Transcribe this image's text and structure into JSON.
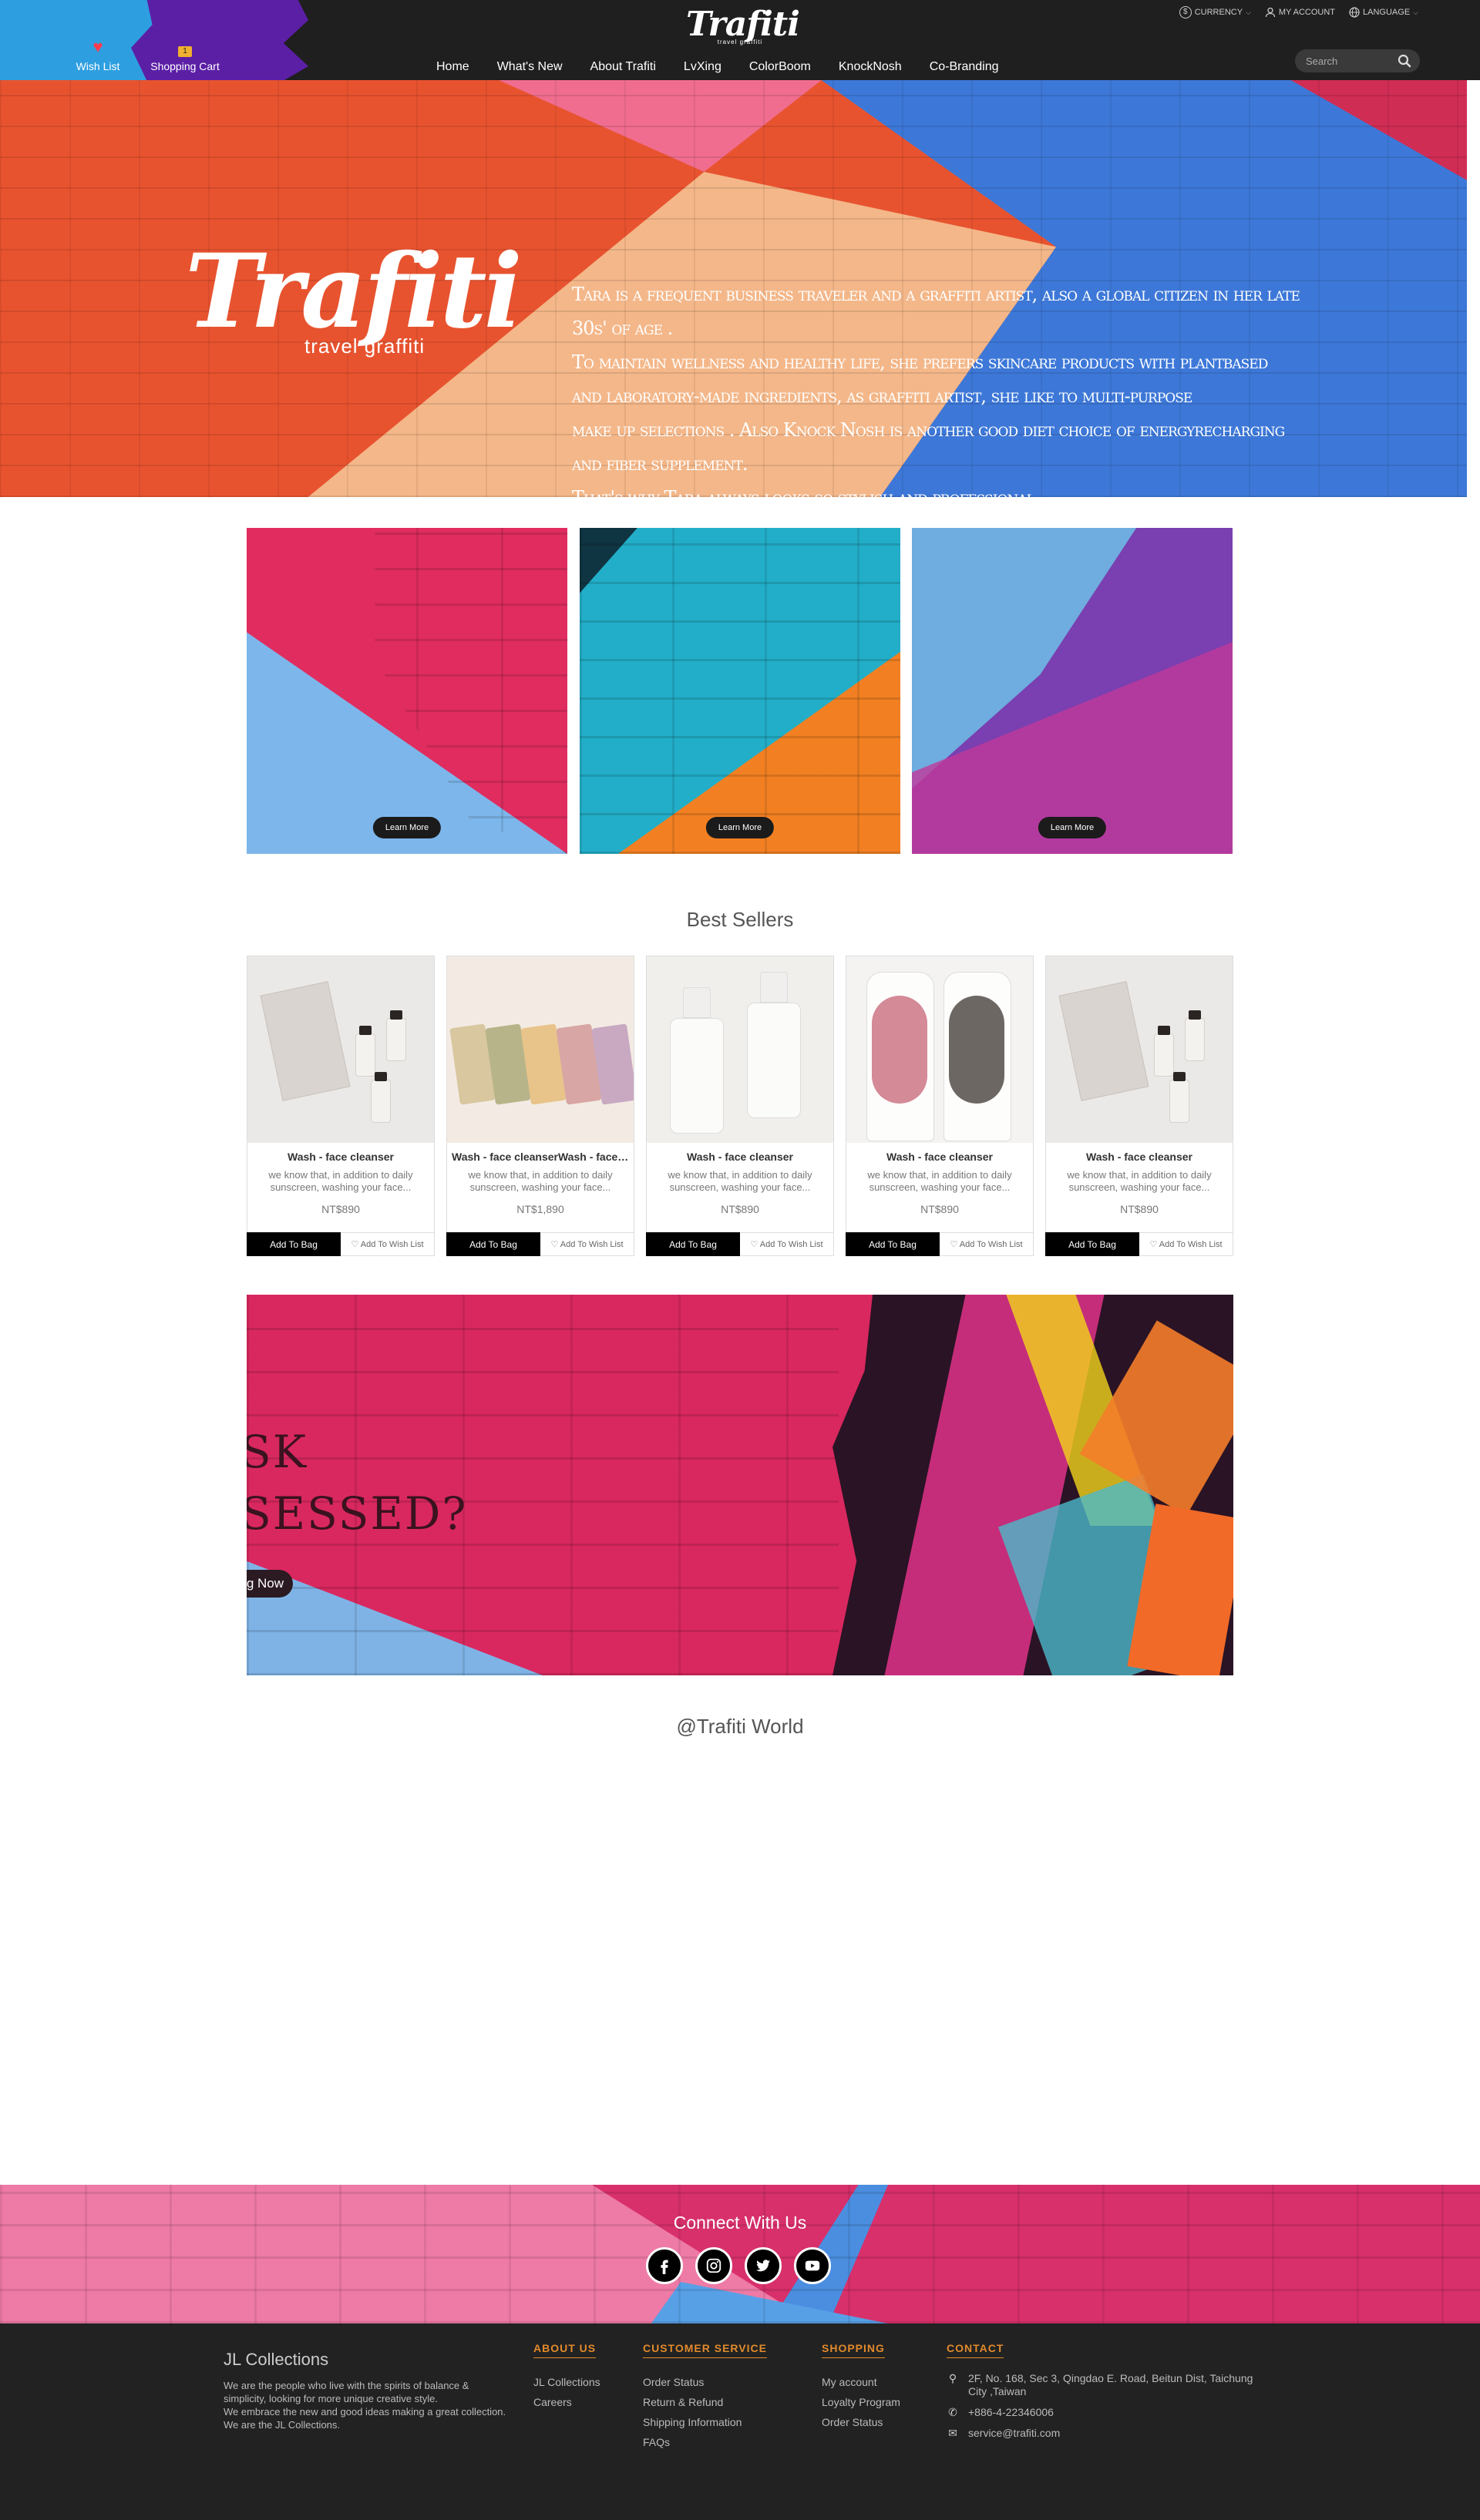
{
  "header": {
    "wish_list": "Wish List",
    "cart_label": "Shopping Cart",
    "cart_count": "1",
    "logo": "Trafiti",
    "logo_sub": "travel graffiti",
    "utils": {
      "currency": "CURRENCY",
      "account": "MY ACCOUNT",
      "language": "LANGUAGE"
    },
    "nav": [
      "Home",
      "What's New",
      "About Trafiti",
      "LvXing",
      "ColorBoom",
      "KnockNosh",
      "Co-Branding"
    ],
    "search_placeholder": "Search"
  },
  "hero": {
    "logo": "Trafiti",
    "logo_sub": "travel     graffiti",
    "lines": [
      "Tara is a frequent business traveler and a graffiti artist, also a global citizen in her late 30s' of age .",
      "To maintain wellness and healthy life, she prefers skincare products with plantbased",
      "and laboratory-made ingredients, as graffiti artist, she like to multi-purpose",
      "make up selections . Also Knock Nosh is another good diet choice of energyrecharging",
      "and fiber supplement.",
      "That's why Tara always looks so stylish and professional"
    ]
  },
  "features": [
    {
      "button": "Learn More"
    },
    {
      "button": "Learn More"
    },
    {
      "button": "Learn More"
    }
  ],
  "best_sellers": {
    "title": "Best Sellers",
    "add_to_bag": "Add To Bag",
    "add_to_wish": "Add To Wish List",
    "products": [
      {
        "name": "Wash - face cleanser",
        "desc": "we know that, in addition to daily sunscreen, washing your face...",
        "price": "NT$890"
      },
      {
        "name": "Wash - face cleanserWash - face cleanser",
        "desc": "we know that, in addition to daily sunscreen, washing your face...",
        "price": "NT$1,890"
      },
      {
        "name": "Wash - face cleanser",
        "desc": "we know that, in addition to daily sunscreen, washing your face...",
        "price": "NT$890"
      },
      {
        "name": "Wash - face cleanser",
        "desc": "we know that, in addition to daily sunscreen, washing your face...",
        "price": "NT$890"
      },
      {
        "name": "Wash - face cleanser",
        "desc": "we know that, in addition to daily sunscreen, washing your face...",
        "price": "NT$890"
      }
    ]
  },
  "promo": {
    "line1": "SK",
    "line2": "SESSED?",
    "button": "g Now"
  },
  "world": {
    "title": "@Trafiti World"
  },
  "connect": {
    "title": "Connect With Us",
    "socials": [
      "facebook-icon",
      "instagram-icon",
      "twitter-icon",
      "youtube-icon"
    ]
  },
  "footer": {
    "brand": "JL Collections",
    "about": "We are the people who live with the spirits of balance & simplicity, looking for more unique creative style.\nWe embrace the new and good ideas making a great collection.\nWe are the JL Collections.",
    "columns": [
      {
        "title": "ABOUT US",
        "items": [
          "JL Collections",
          "Careers"
        ]
      },
      {
        "title": "CUSTOMER SERVICE",
        "items": [
          "Order Status",
          "Return & Refund",
          "Shipping Information",
          "FAQs"
        ]
      },
      {
        "title": "SHOPPING",
        "items": [
          "My account",
          "Loyalty Program",
          "Order Status"
        ]
      }
    ],
    "contact": {
      "title": "CONTACT",
      "address": "2F, No. 168, Sec 3, Qingdao E. Road, Beitun Dist, Taichung City ,Taiwan",
      "phone": "+886-4-22346006",
      "email": "service@trafiti.com"
    }
  }
}
